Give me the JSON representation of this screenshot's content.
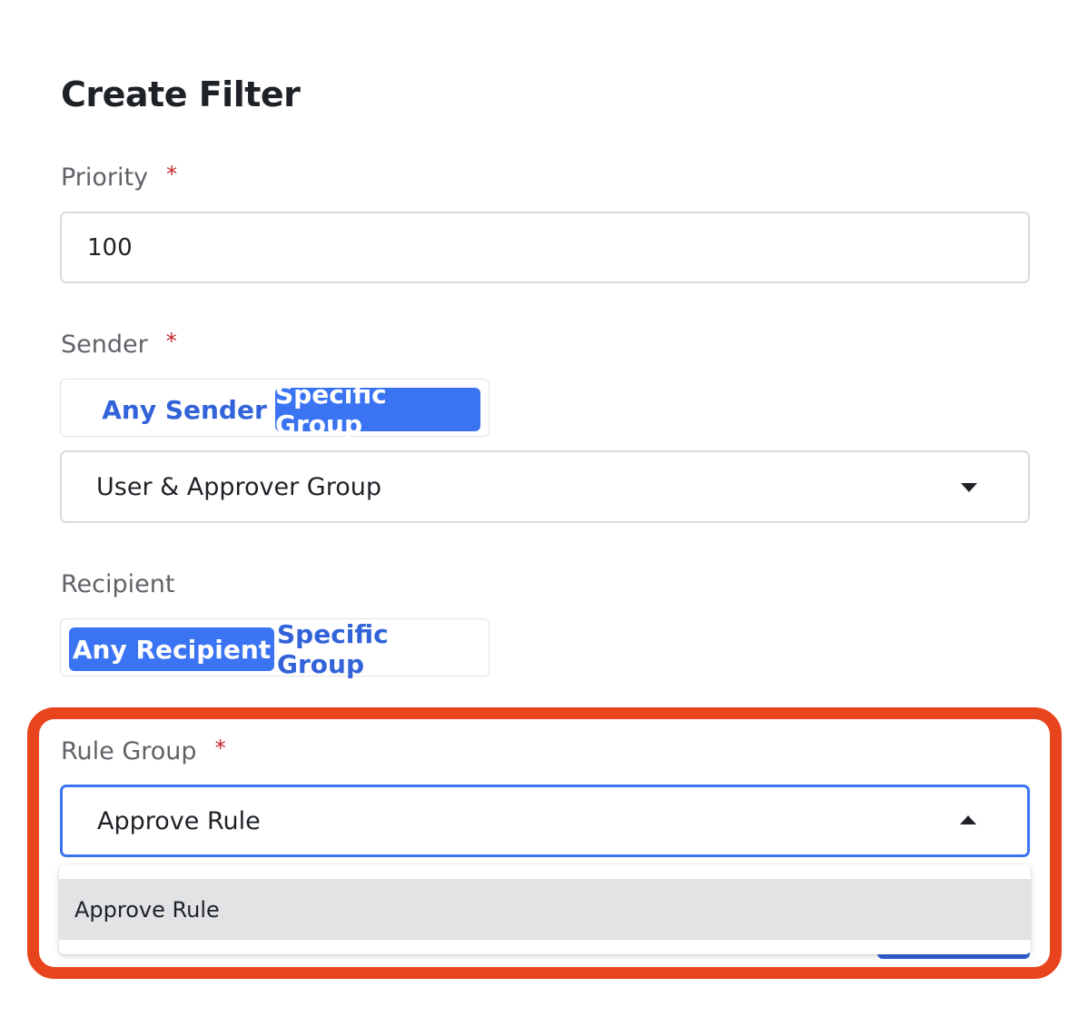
{
  "dialog": {
    "title": "Create Filter"
  },
  "priority": {
    "label": "Priority",
    "required_mark": "*",
    "value": "100"
  },
  "sender": {
    "label": "Sender",
    "required_mark": "*",
    "options": [
      "Any Sender",
      "Specific Group"
    ],
    "selected_option": "Specific Group",
    "group_select_value": "User & Approver Group"
  },
  "recipient": {
    "label": "Recipient",
    "options": [
      "Any Recipient",
      "Specific Group"
    ],
    "selected_option": "Any Recipient"
  },
  "rule_group": {
    "label": "Rule Group",
    "required_mark": "*",
    "value": "Approve Rule",
    "dropdown_open": true,
    "dropdown_options": [
      "Approve Rule"
    ],
    "hovered_option": "Approve Rule"
  },
  "colors": {
    "accent": "#3b74f2",
    "link_text": "#3263d9",
    "required": "#c5262e",
    "highlight_outline": "#e8451e"
  },
  "icons": {
    "select_caret_closed": "caret-down-icon",
    "select_caret_open": "caret-up-icon"
  }
}
